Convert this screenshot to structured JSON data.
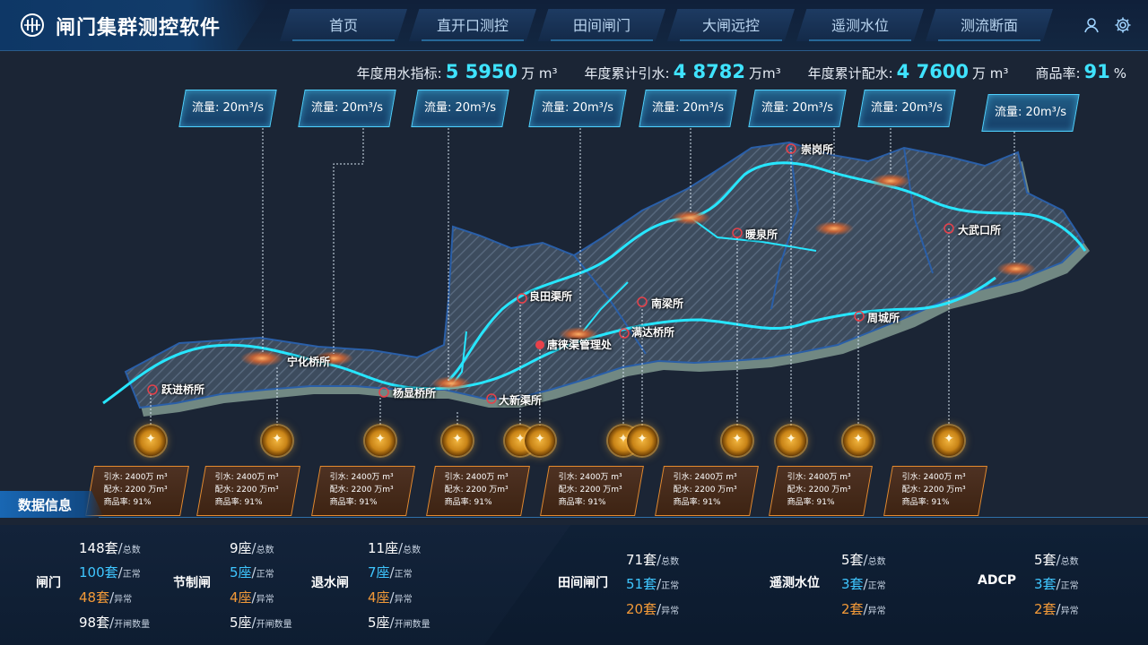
{
  "app": {
    "title": "闸门集群测控软件"
  },
  "nav": [
    "首页",
    "直开口测控",
    "田间闸门",
    "大闸远控",
    "遥测水位",
    "测流断面"
  ],
  "header_icons": [
    "user-icon",
    "gear-icon"
  ],
  "kpis": [
    {
      "label": "年度用水指标:",
      "value": "5 5950",
      "unit": "万 m³"
    },
    {
      "label": "年度累计引水:",
      "value": "4 8782",
      "unit": "万m³"
    },
    {
      "label": "年度累计配水:",
      "value": "4 7600",
      "unit": "万 m³"
    },
    {
      "label": "商品率:",
      "value": "91",
      "unit": "%"
    }
  ],
  "flow_tags": [
    "流量: 20m³/s",
    "流量: 20m³/s",
    "流量: 20m³/s",
    "流量: 20m³/s",
    "流量: 20m³/s",
    "流量: 20m³/s",
    "流量: 20m³/s",
    "流量: 20m³/s"
  ],
  "stations": [
    "跃进桥所",
    "宁化桥所",
    "杨显桥所",
    "大新渠所",
    "良田渠所",
    "唐徕渠管理处",
    "南梁所",
    "满达桥所",
    "暖泉所",
    "崇岗所",
    "大武口所",
    "周城所"
  ],
  "cards": [
    {
      "l1": "引水: 2400万 m³",
      "l2": "配水: 2200 万m³",
      "l3": "商品率: 91%"
    },
    {
      "l1": "引水: 2400万 m³",
      "l2": "配水: 2200 万m³",
      "l3": "商品率: 91%"
    },
    {
      "l1": "引水: 2400万 m³",
      "l2": "配水: 2200 万m³",
      "l3": "商品率: 91%"
    },
    {
      "l1": "引水: 2400万 m³",
      "l2": "配水: 2200 万m³",
      "l3": "商品率: 91%"
    },
    {
      "l1": "引水: 2400万 m³",
      "l2": "配水: 2200 万m³",
      "l3": "商品率: 91%"
    },
    {
      "l1": "引水: 2400万 m³",
      "l2": "配水: 2200 万m³",
      "l3": "商品率: 91%"
    },
    {
      "l1": "引水: 2400万 m³",
      "l2": "配水: 2200 万m³",
      "l3": "商品率: 91%"
    },
    {
      "l1": "引水: 2400万 m³",
      "l2": "配水: 2200 万m³",
      "l3": "商品率: 91%"
    }
  ],
  "data_panel": {
    "title": "数据信息",
    "groups": [
      {
        "name": "闸门",
        "stats": [
          {
            "value": "148套",
            "label": "总数",
            "color": "white"
          },
          {
            "value": "100套",
            "label": "正常",
            "color": "cyan"
          },
          {
            "value": "48套",
            "label": "异常",
            "color": "orange"
          },
          {
            "value": "98套",
            "label": "开闸数量",
            "color": "white"
          }
        ]
      },
      {
        "name": "节制闸",
        "stats": [
          {
            "value": "9座",
            "label": "总数",
            "color": "white"
          },
          {
            "value": "5座",
            "label": "正常",
            "color": "cyan"
          },
          {
            "value": "4座",
            "label": "异常",
            "color": "orange"
          },
          {
            "value": "5座",
            "label": "开闸数量",
            "color": "white"
          }
        ]
      },
      {
        "name": "退水闸",
        "stats": [
          {
            "value": "11座",
            "label": "总数",
            "color": "white"
          },
          {
            "value": "7座",
            "label": "正常",
            "color": "cyan"
          },
          {
            "value": "4座",
            "label": "异常",
            "color": "orange"
          },
          {
            "value": "5座",
            "label": "开闸数量",
            "color": "white"
          }
        ]
      },
      {
        "name": "田间闸门",
        "stats": [
          {
            "value": "71套",
            "label": "总数",
            "color": "white"
          },
          {
            "value": "51套",
            "label": "正常",
            "color": "cyan"
          },
          {
            "value": "20套",
            "label": "异常",
            "color": "orange"
          }
        ]
      },
      {
        "name": "遥测水位",
        "stats": [
          {
            "value": "5套",
            "label": "总数",
            "color": "white"
          },
          {
            "value": "3套",
            "label": "正常",
            "color": "cyan"
          },
          {
            "value": "2套",
            "label": "异常",
            "color": "orange"
          }
        ]
      },
      {
        "name": "ADCP",
        "stats": [
          {
            "value": "5套",
            "label": "总数",
            "color": "white"
          },
          {
            "value": "3套",
            "label": "正常",
            "color": "cyan"
          },
          {
            "value": "2套",
            "label": "异常",
            "color": "orange"
          }
        ]
      }
    ]
  },
  "colors": {
    "accent": "#3fe3ff",
    "warn": "#f39a38",
    "normal": "#3fc6ff",
    "river": "#27e6ff"
  }
}
